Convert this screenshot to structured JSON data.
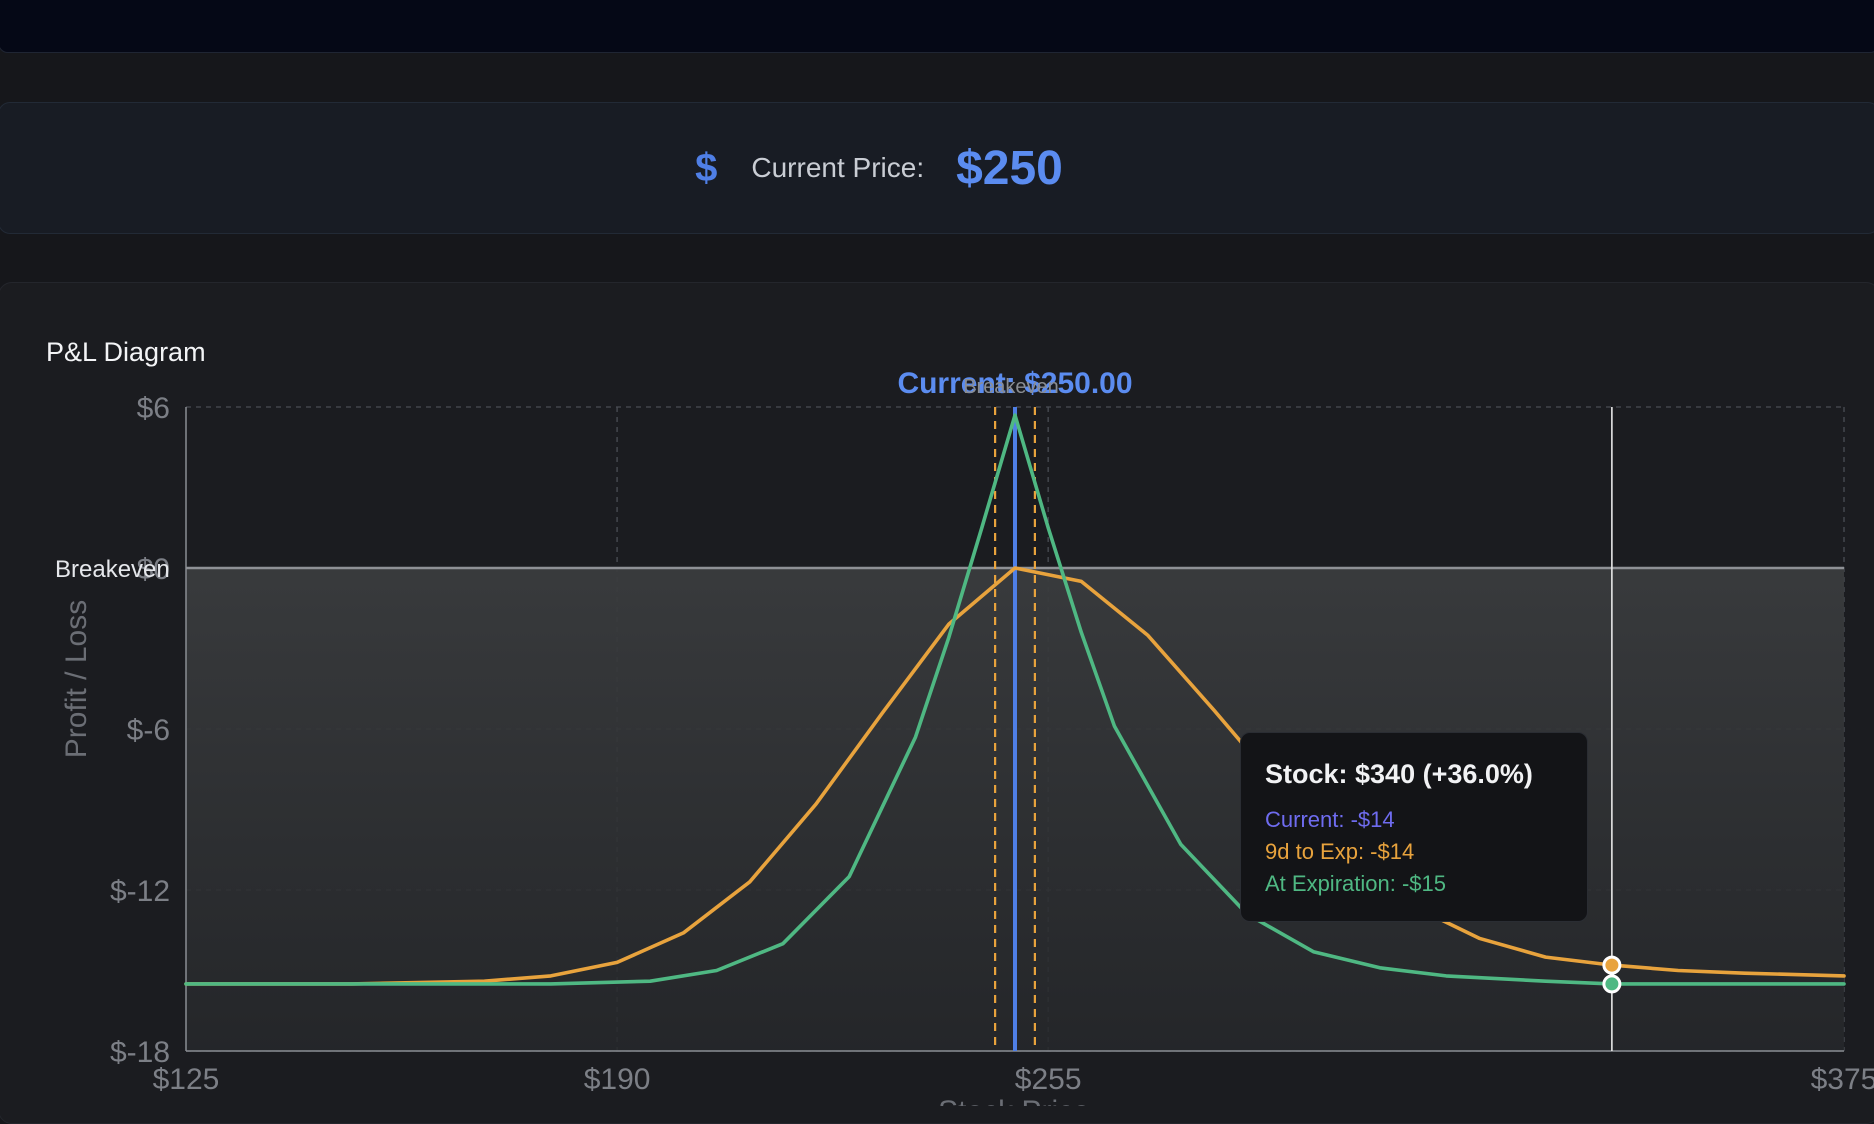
{
  "price_card": {
    "icon": "dollar-icon",
    "label": "Current Price:",
    "value": "$250"
  },
  "chart_title": "P&L Diagram",
  "tooltip": {
    "title": "Stock: $340 (+36.0%)",
    "rows": [
      {
        "label": "Current: -$14",
        "color": "#6f6cf0"
      },
      {
        "label": "9d to Exp: -$14",
        "color": "#e8a33d"
      },
      {
        "label": "At Expiration: -$15",
        "color": "#4fb883"
      }
    ]
  },
  "chart_data": {
    "type": "line",
    "xlabel": "Stock Price",
    "ylabel": "Profit / Loss",
    "xlim": [
      125,
      375
    ],
    "ylim": [
      -18,
      6
    ],
    "x_ticks": [
      "$125",
      "$190",
      "$255",
      "$375"
    ],
    "y_ticks": [
      "$6",
      "$0",
      "$-6",
      "$-12",
      "$-18"
    ],
    "x_tick_values": [
      125,
      190,
      255,
      375
    ],
    "y_tick_values": [
      6,
      0,
      -6,
      -12,
      -18
    ],
    "grid": true,
    "breakeven_label": "Breakeven",
    "current_price_label": "Current: $250.00",
    "breakeven_top_label": "Breakeven",
    "current_price": 250,
    "breakevens": [
      247,
      253
    ],
    "hover_x": 340,
    "series": [
      {
        "name": "9d to Exp",
        "color": "#e8a33d",
        "x": [
          125,
          150,
          170,
          180,
          190,
          200,
          210,
          220,
          230,
          240,
          250,
          260,
          270,
          280,
          290,
          300,
          310,
          320,
          330,
          340,
          350,
          360,
          375
        ],
        "y": [
          -15.5,
          -15.5,
          -15.4,
          -15.2,
          -14.7,
          -13.6,
          -11.7,
          -8.8,
          -5.4,
          -2.1,
          0,
          -0.5,
          -2.5,
          -5.3,
          -8.2,
          -10.7,
          -12.6,
          -13.8,
          -14.5,
          -14.8,
          -15.0,
          -15.1,
          -15.2
        ]
      },
      {
        "name": "At Expiration",
        "color": "#4fb883",
        "x": [
          125,
          150,
          180,
          195,
          205,
          215,
          225,
          235,
          240,
          245,
          250,
          255,
          260,
          265,
          275,
          285,
          295,
          305,
          315,
          330,
          340,
          375
        ],
        "y": [
          -15.5,
          -15.5,
          -15.5,
          -15.4,
          -15.0,
          -14.0,
          -11.5,
          -6.3,
          -2.6,
          1.5,
          5.7,
          1.5,
          -2.4,
          -5.9,
          -10.3,
          -12.9,
          -14.3,
          -14.9,
          -15.2,
          -15.4,
          -15.5,
          -15.5
        ]
      }
    ]
  }
}
